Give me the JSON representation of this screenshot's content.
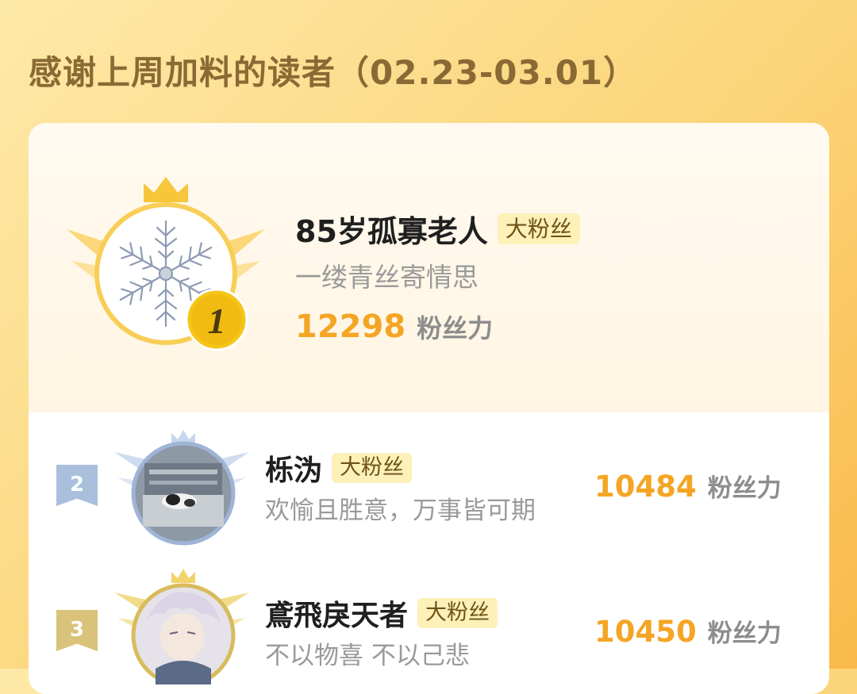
{
  "header": {
    "title": "感谢上周加料的读者（02.23-03.01）"
  },
  "leaderboard": [
    {
      "rank": "1",
      "name": "85岁孤寡老人",
      "badge": "大粉丝",
      "motto": "一缕青丝寄情思",
      "score": "12298",
      "unit": "粉丝力",
      "avatar": "snowflake-avatar"
    },
    {
      "rank": "2",
      "name": "栎沩",
      "badge": "大粉丝",
      "motto": "欢愉且胜意，万事皆可期",
      "score": "10484",
      "unit": "粉丝力",
      "avatar": "cat-photo-avatar"
    },
    {
      "rank": "3",
      "name": "鳶飛戾天者",
      "badge": "大粉丝",
      "motto": "不以物喜 不以己悲",
      "score": "10450",
      "unit": "粉丝力",
      "avatar": "anime-character-avatar"
    }
  ],
  "colors": {
    "accent_score": "#f4a524",
    "gold": "#f5c518",
    "silver_tag": "#a9bfdc",
    "bronze_tag": "#d9c27a"
  }
}
